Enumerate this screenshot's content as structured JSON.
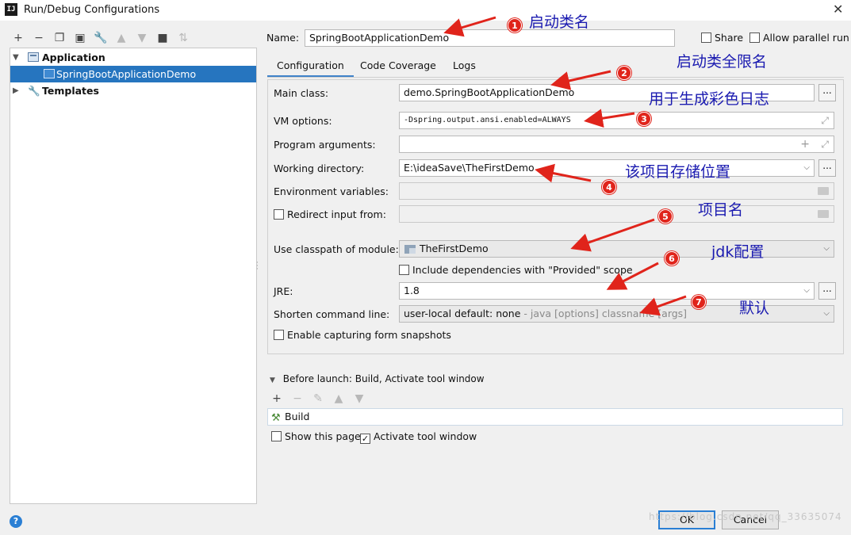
{
  "window": {
    "title": "Run/Debug Configurations",
    "app_icon_text": "IJ"
  },
  "toolbar": {
    "icons": [
      "add-icon",
      "remove-icon",
      "copy-icon",
      "save-icon",
      "wrench-icon",
      "move-up-icon",
      "move-down-icon",
      "folder-icon",
      "sort-icon"
    ]
  },
  "tree": {
    "application_label": "Application",
    "config_label": "SpringBootApplicationDemo",
    "templates_label": "Templates"
  },
  "name_row": {
    "label": "Name:",
    "value": "SpringBootApplicationDemo",
    "share_label": "Share",
    "allow_parallel_label": "Allow parallel run"
  },
  "tabs": [
    {
      "label": "Configuration"
    },
    {
      "label": "Code Coverage"
    },
    {
      "label": "Logs"
    }
  ],
  "form": {
    "main_class_label": "Main class:",
    "main_class_value": "demo.SpringBootApplicationDemo",
    "vm_options_label": "VM options:",
    "vm_options_value": "-Dspring.output.ansi.enabled=ALWAYS",
    "program_args_label": "Program arguments:",
    "program_args_value": "",
    "working_dir_label": "Working directory:",
    "working_dir_value": "E:\\ideaSave\\TheFirstDemo",
    "env_vars_label": "Environment variables:",
    "env_vars_value": "",
    "redirect_label": "Redirect input from:",
    "classpath_label": "Use classpath of module:",
    "classpath_value": "TheFirstDemo",
    "include_deps_label": "Include dependencies with \"Provided\" scope",
    "jre_label": "JRE:",
    "jre_value": "1.8",
    "shorten_label": "Shorten command line:",
    "shorten_value": "user-local default: none",
    "shorten_hint": " - java [options] classname [args]",
    "snapshots_label": "Enable capturing form snapshots",
    "dots": "..."
  },
  "before_launch": {
    "header": "Before launch: Build, Activate tool window",
    "task": "Build",
    "show_page_label": "Show this page",
    "activate_label": "Activate tool window"
  },
  "buttons": {
    "ok": "OK",
    "cancel": "Cancel"
  },
  "watermark": "https://blog.csdn.net/qq_33635074",
  "annotations": [
    {
      "num": "1",
      "text": "启动类名"
    },
    {
      "num": "2",
      "text": "启动类全限名"
    },
    {
      "num": "3",
      "text": "用于生成彩色日志"
    },
    {
      "num": "4",
      "text": "该项目存储位置"
    },
    {
      "num": "5",
      "text": "项目名"
    },
    {
      "num": "6",
      "text": "jdk配置"
    },
    {
      "num": "7",
      "text": "默认"
    }
  ],
  "colors": {
    "selection": "#2675bf",
    "annotation_red": "#e0241b",
    "annotation_text": "#1a1ab0",
    "focus_blue": "#2a7fd4"
  }
}
